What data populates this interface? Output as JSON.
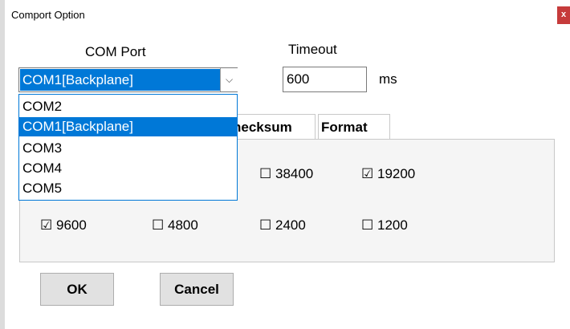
{
  "window": {
    "title": "Comport Option",
    "close_glyph": "x"
  },
  "com_port": {
    "label": "COM Port",
    "selected": "COM1[Backplane]",
    "arrow_glyph": "⌵",
    "options": [
      "COM2",
      "COM1[Backplane]",
      "COM3",
      "COM4",
      "COM5"
    ]
  },
  "timeout": {
    "label": "Timeout",
    "value": "600",
    "unit": "ms"
  },
  "tabs": [
    "hecksum",
    "Format"
  ],
  "baud_rates": [
    {
      "label": "38400",
      "checked": false
    },
    {
      "label": "19200",
      "checked": true
    },
    {
      "label": "9600",
      "checked": true
    },
    {
      "label": "4800",
      "checked": false
    },
    {
      "label": "2400",
      "checked": false
    },
    {
      "label": "1200",
      "checked": false
    }
  ],
  "buttons": {
    "ok": "OK",
    "cancel": "Cancel"
  },
  "colors": {
    "selection": "#0078d7",
    "close": "#c63b3b"
  }
}
